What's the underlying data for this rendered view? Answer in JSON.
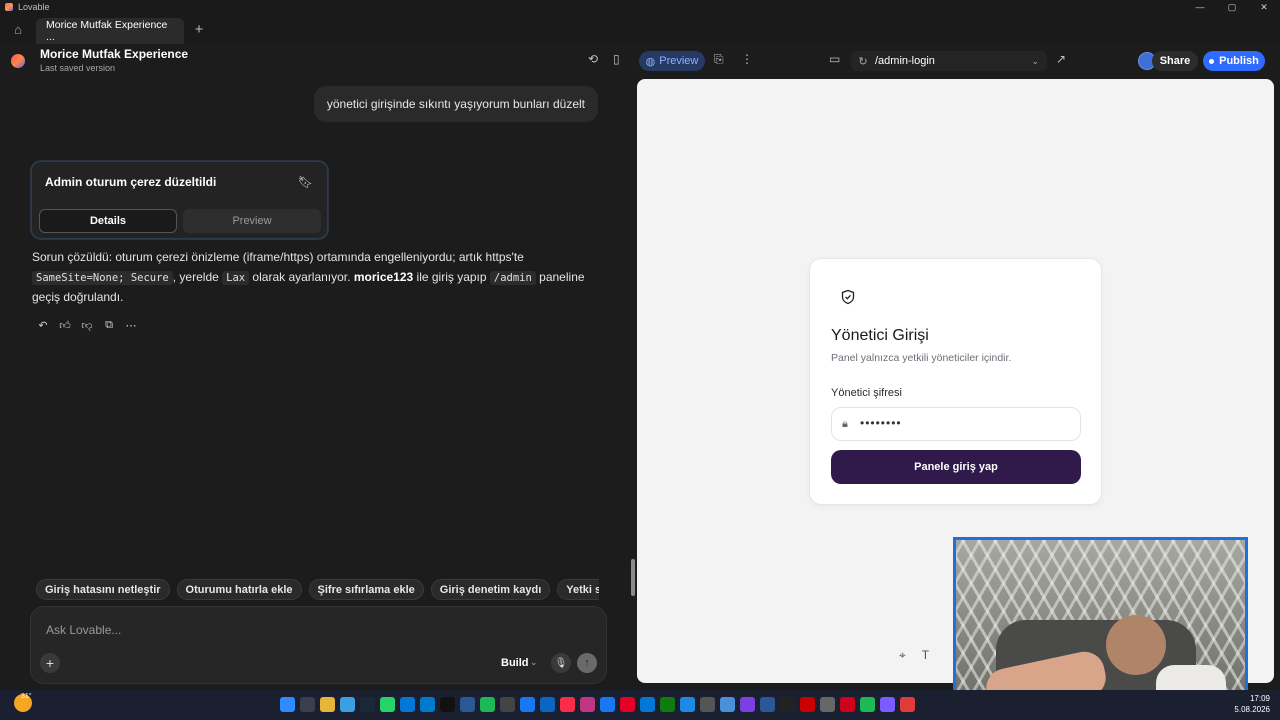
{
  "os": {
    "app_title": "Lovable"
  },
  "browser": {
    "tab_title": "Morice Mutfak Experience ..."
  },
  "header": {
    "project_name": "Morice Mutfak Experience",
    "project_sub": "Last saved version",
    "preview_label": "Preview",
    "route": "/admin-login",
    "share_label": "Share",
    "publish_label": "Publish"
  },
  "chat": {
    "user_message": "yönetici girişinde sıkıntı yaşıyorum bunları düzelt",
    "card": {
      "title": "Admin oturum çerez düzeltildi",
      "tab_details": "Details",
      "tab_preview": "Preview"
    },
    "answer": {
      "t1": "Sorun çözüldü: oturum çerezi önizleme (iframe/https) ortamında engelleniyordu; artık https'te ",
      "code1": "SameSite=None; Secure",
      "t2": ", yerelde ",
      "code2": "Lax",
      "t3": " olarak ayarlanıyor. ",
      "bold1": "morice123",
      "t4": " ile giriş yapıp ",
      "code3": "/admin",
      "t5": " paneline geçiş doğrulandı."
    },
    "chips": [
      "Giriş hatasını netleştir",
      "Oturumu hatırla ekle",
      "Şifre sıfırlama ekle",
      "Giriş denetim kaydı",
      "Yetki seviyeleri kur"
    ],
    "input_placeholder": "Ask Lovable...",
    "mode_label": "Build"
  },
  "preview": {
    "title": "Yönetici Girişi",
    "subtitle": "Panel yalnızca yetkili yöneticiler içindir.",
    "password_label": "Yönetici şifresi",
    "password_value": "••••••••",
    "login_button": "Panele giriş yap"
  },
  "taskbar": {
    "temperature": "31°",
    "time": "17:09",
    "date": "5.08.2026"
  }
}
